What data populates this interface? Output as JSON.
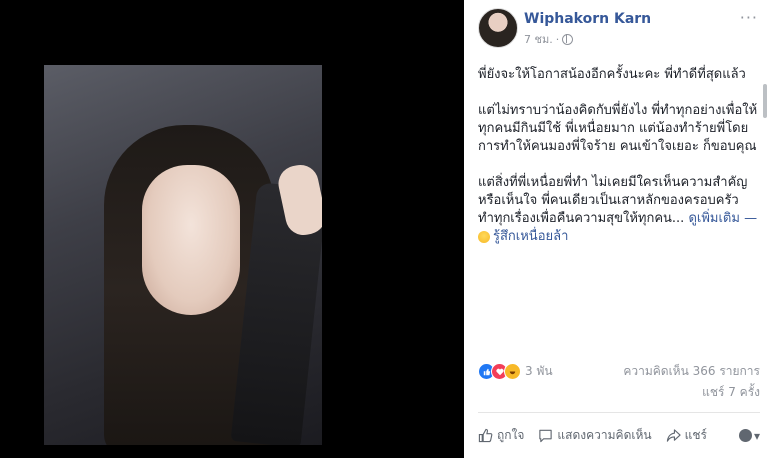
{
  "post": {
    "author": "Wiphakorn Karn",
    "time": "7 ชม.",
    "more": "···",
    "paragraphs": [
      "พี่ยังจะให้โอกาสน้องอีกครั้งนะคะ พี่ทำดีที่สุดแล้ว",
      "แต่ไม่ทราบว่าน้องคิดกับพี่ยังไง พี่ทำทุกอย่างเพื่อให้ทุกคนมีกินมีใช้ พี่เหนื่อยมาก แต่น้องทำร้ายพี่โดยการทำให้คนมองพี่ใจร้าย คนเข้าใจเยอะ ก็ขอบคุณ",
      "แต่สิ่งที่พี่เหนื่อยพี่ทำ ไม่เคยมีใครเห็นความสำคัญหรือเห็นใจ พี่คนเดียวเป็นเสาหลักของครอบครัว ทำทุกเรื่องเพื่อคืนความสุขให้ทุกคน..."
    ],
    "see_more": "ดูเพิ่มเติม",
    "see_more_suffix": " —",
    "feeling": "รู้สึกเหนื่อยล้า"
  },
  "stats": {
    "reaction_count": "3 พัน",
    "comments": "ความคิดเห็น 366 รายการ",
    "shares": "แชร์ 7 ครั้ง"
  },
  "actions": {
    "like": "ถูกใจ",
    "comment": "แสดงความคิดเห็น",
    "share": "แชร์",
    "audience_caret": "▾"
  },
  "colors": {
    "link": "#365899",
    "like": "#2078f4",
    "love": "#f33e58",
    "haha": "#f7b928"
  },
  "icons": [
    "like-reaction-icon",
    "love-reaction-icon",
    "haha-reaction-icon",
    "globe-icon",
    "thumbs-up-icon",
    "comment-icon",
    "share-icon",
    "tired-emoji-icon"
  ]
}
